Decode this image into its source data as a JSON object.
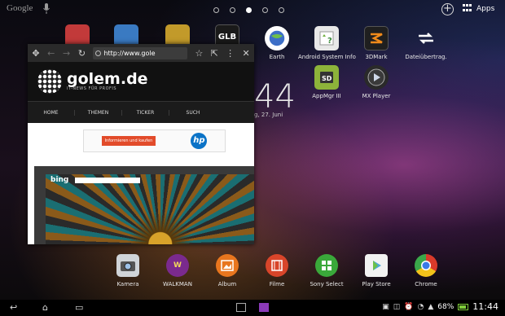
{
  "topbar": {
    "search_label": "Google",
    "page_count": 5,
    "active_page": 3,
    "apps_label": "Apps"
  },
  "home_icons": [
    {
      "name": "Earth",
      "label": "Earth",
      "icon": "earth-icon",
      "color": "#3d6fc7"
    },
    {
      "name": "Android System Info",
      "label": "Android System Info",
      "icon": "system-info-icon",
      "color": "#6fae3d"
    },
    {
      "name": "3DMark",
      "label": "3DMark",
      "icon": "3dmark-icon",
      "color": "#222222"
    },
    {
      "name": "Dateiübertrag.",
      "label": "Dateiübertrag.",
      "icon": "transfer-icon",
      "color": "#ffffff"
    },
    {
      "name": "AppMgr III",
      "label": "AppMgr III",
      "icon": "sd-card-icon",
      "color": "#8db33a"
    },
    {
      "name": "MX Player",
      "label": "MX Player",
      "icon": "play-icon",
      "color": "#3a3a3a"
    }
  ],
  "partial_icons": [
    {
      "label": "GLB",
      "icon": "glbenchmark-icon"
    }
  ],
  "clock": {
    "time_partial": "44",
    "date_partial": "g, 27. Juni"
  },
  "browser": {
    "url": "http://www.gole",
    "site_title": "golem.de",
    "site_subtitle": "IT-NEWS FÜR PROFIS",
    "nav": [
      "HOME",
      "THEMEN",
      "TICKER",
      "SUCH"
    ],
    "ad_button": "Informieren und kaufen",
    "ad_logo": "hp",
    "embedded_label": "bing"
  },
  "dock": [
    {
      "label": "Kamera",
      "icon": "camera-icon",
      "color": "#9aa0a8"
    },
    {
      "label": "WALKMAN",
      "icon": "walkman-icon",
      "color": "#8a2a9a"
    },
    {
      "label": "Album",
      "icon": "album-icon",
      "color": "#e8761e"
    },
    {
      "label": "Filme",
      "icon": "movies-icon",
      "color": "#d8452a"
    },
    {
      "label": "Sony Select",
      "icon": "sony-select-icon",
      "color": "#3aa83a"
    },
    {
      "label": "Play Store",
      "icon": "play-store-icon",
      "color": "#f2f2f2"
    },
    {
      "label": "Chrome",
      "icon": "chrome-icon",
      "color": "#d93a2a"
    }
  ],
  "statusbar": {
    "battery_percent": "68%",
    "time": "11:44"
  }
}
